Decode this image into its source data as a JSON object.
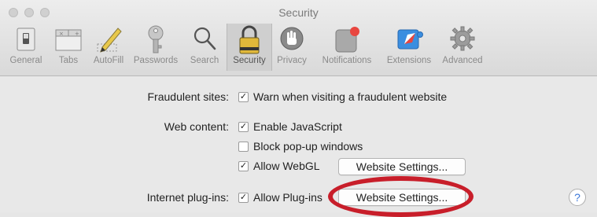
{
  "window": {
    "title": "Security"
  },
  "toolbar": {
    "items": [
      {
        "label": "General",
        "icon": "general-switch-icon"
      },
      {
        "label": "Tabs",
        "icon": "tabs-icon"
      },
      {
        "label": "AutoFill",
        "icon": "autofill-pencil-icon"
      },
      {
        "label": "Passwords",
        "icon": "key-icon"
      },
      {
        "label": "Search",
        "icon": "magnifier-icon"
      },
      {
        "label": "Security",
        "icon": "lock-icon",
        "selected": true
      },
      {
        "label": "Privacy",
        "icon": "hand-icon"
      },
      {
        "label": "Notifications",
        "icon": "notification-icon"
      },
      {
        "label": "Extensions",
        "icon": "compass-puzzle-icon"
      },
      {
        "label": "Advanced",
        "icon": "gear-icon"
      }
    ]
  },
  "content": {
    "fraudulent": {
      "label": "Fraudulent sites:",
      "option": "Warn when visiting a fraudulent website",
      "checked": true
    },
    "web_content": {
      "label": "Web content:",
      "enable_js": {
        "text": "Enable JavaScript",
        "checked": true
      },
      "block_popups": {
        "text": "Block pop-up windows",
        "checked": false
      },
      "allow_webgl": {
        "text": "Allow WebGL",
        "checked": true
      },
      "webgl_button": "Website Settings..."
    },
    "plugins": {
      "label": "Internet plug-ins:",
      "allow_plugins": {
        "text": "Allow Plug-ins",
        "checked": true
      },
      "plugins_button": "Website Settings..."
    },
    "help": "?"
  },
  "colors": {
    "annotation_circle": "#c81e2a",
    "help_accent": "#3a76d8"
  }
}
